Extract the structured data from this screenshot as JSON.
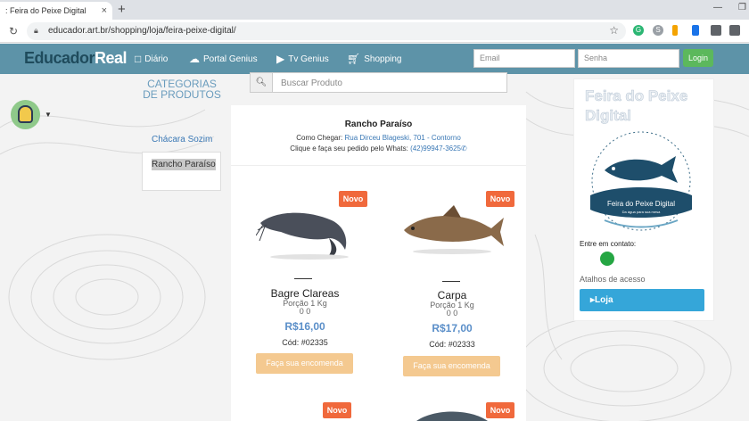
{
  "browser": {
    "tab_title": ": Feira do Peixe Digital",
    "tab_close": "×",
    "new_tab": "+",
    "url": "educador.art.br/shopping/loja/feira-peixe-digital/",
    "minimize": "—",
    "restore": "❐"
  },
  "site": {
    "logo_part1": "Educador",
    "logo_part2": "Real",
    "nav": [
      {
        "label": "Diário",
        "icon": "book-icon"
      },
      {
        "label": "Portal Genius",
        "icon": "cloud-icon"
      },
      {
        "label": "Tv Genius",
        "icon": "play-icon"
      },
      {
        "label": "Shopping",
        "icon": "cart-icon"
      }
    ],
    "email_placeholder": "Email",
    "password_placeholder": "Senha",
    "login_label": "Login"
  },
  "sidebar": {
    "categories_title": "CATEGORIAS DE PRODUTOS",
    "category_link": "Chácara Sozim",
    "selected_store": "Rancho Paraíso"
  },
  "search": {
    "placeholder": "Buscar Produto"
  },
  "store": {
    "name": "Rancho Paraíso",
    "directions_label": "Como Chegar:",
    "directions_value": "Rua Dirceu Blageski, 701 - Contorno",
    "whats_label": "Clique e faça seu pedido pelo Whats:",
    "whats_value": "(42)99947-3625"
  },
  "products": [
    {
      "badge": "Novo",
      "name": "Bagre Clareas",
      "portion": "Porção 1 Kg",
      "rating": "0 0",
      "price": "R$16,00",
      "code": "Cód: #02335",
      "order": "Faça sua encomenda"
    },
    {
      "badge": "Novo",
      "name": "Carpa",
      "portion": "Porção 1 Kg",
      "rating": "0 0",
      "price": "R$17,00",
      "code": "Cód: #02333",
      "order": "Faça sua encomenda"
    },
    {
      "badge": "Novo"
    },
    {
      "badge": "Novo"
    }
  ],
  "right_panel": {
    "title": "Feira do Peixe Digital",
    "logo_text": "Feira do Peixe Digital",
    "logo_tagline": "Da água para sua mesa",
    "contact_label": "Entre em contato:",
    "shortcuts_label": "Atalhos de acesso",
    "loja_label": "Loja"
  }
}
